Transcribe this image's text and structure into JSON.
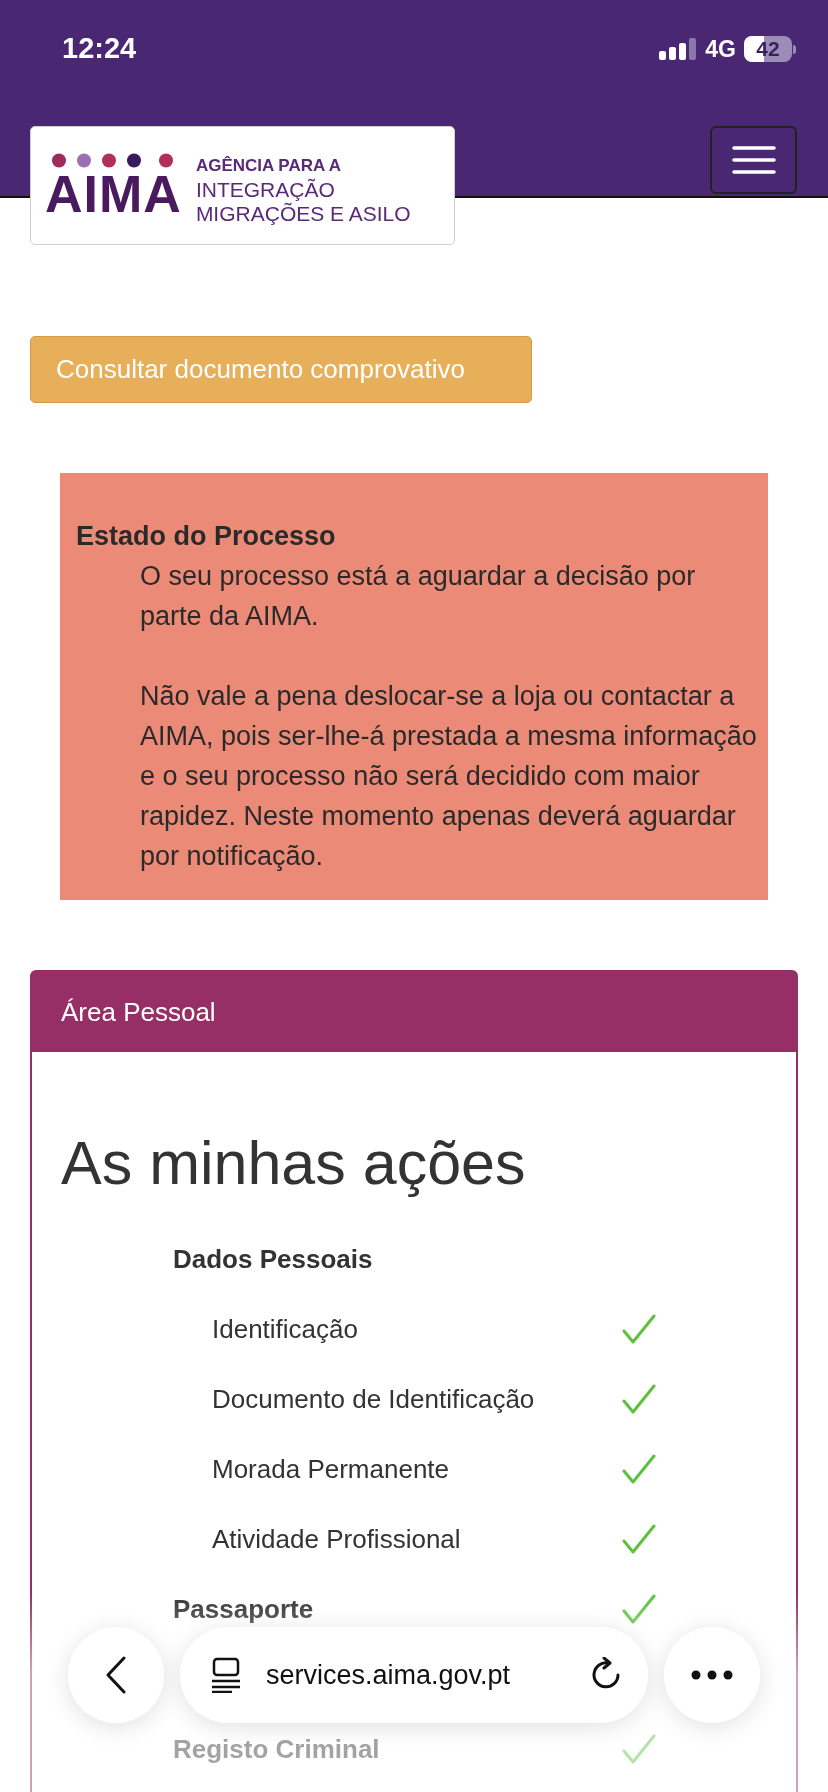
{
  "status_bar": {
    "time": "12:24",
    "network": "4G",
    "battery": "42"
  },
  "header": {
    "logo": {
      "mark": "AIMA",
      "lines": [
        "AGÊNCIA PARA A",
        "INTEGRAÇÃO",
        "MIGRAÇÕES E ASILO"
      ]
    }
  },
  "document_button": "Consultar documento comprovativo",
  "process_status": {
    "title": "Estado do Processo",
    "paragraphs": [
      "O seu processo está a aguardar a decisão por parte da AIMA.",
      "Não vale a pena deslocar-se a loja ou contactar a AIMA, pois ser-lhe-á prestada a mesma informação e o seu processo não será decidido com maior rapidez. Neste momento apenas deverá aguardar por notificação."
    ]
  },
  "personal_area": {
    "title": "Área Pessoal",
    "heading": "As minhas ações",
    "sections": [
      {
        "label": "Dados Pessoais",
        "children": [
          {
            "label": "Identificação",
            "done": true
          },
          {
            "label": "Documento de Identificação",
            "done": true
          },
          {
            "label": "Morada Permanente",
            "done": true
          },
          {
            "label": "Atividade Profissional",
            "done": true
          }
        ]
      },
      {
        "label": "Passaporte",
        "done": true
      },
      {
        "label": "Registo Criminal",
        "done": true
      }
    ]
  },
  "browser_bar": {
    "url": "services.aima.gov.pt"
  }
}
